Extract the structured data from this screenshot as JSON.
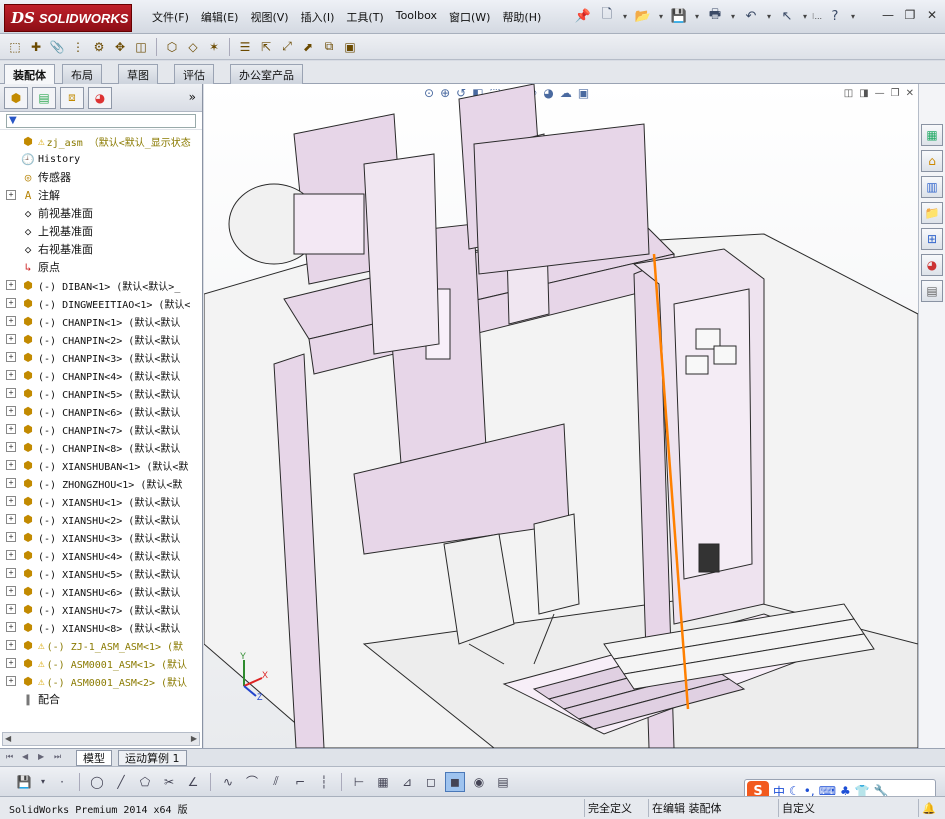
{
  "titlebar": {
    "brand_ds": "DS",
    "brand_name": "SOLIDWORKS",
    "menus": [
      "文件(F)",
      "编辑(E)",
      "视图(V)",
      "插入(I)",
      "工具(T)",
      "Toolbox",
      "窗口(W)",
      "帮助(H)"
    ],
    "overflow": "⁝...",
    "help": "?"
  },
  "command_tabs": [
    "装配体",
    "布局",
    "草图",
    "评估",
    "办公室产品"
  ],
  "feature_tree": {
    "root_label": "zj_asm （默认<默认_显示状态",
    "items": [
      {
        "label": "History",
        "type": "history"
      },
      {
        "label": "传感器",
        "type": "sensor"
      },
      {
        "label": "注解",
        "type": "annotation"
      },
      {
        "label": "前视基准面",
        "type": "plane"
      },
      {
        "label": "上视基准面",
        "type": "plane"
      },
      {
        "label": "右视基准面",
        "type": "plane"
      },
      {
        "label": "原点",
        "type": "origin"
      },
      {
        "label": "(-) DIBAN<1> (默认<默认>_",
        "type": "part"
      },
      {
        "label": "(-) DINGWEEITIAO<1> (默认<",
        "type": "part"
      },
      {
        "label": "(-) CHANPIN<1> (默认<默认",
        "type": "part"
      },
      {
        "label": "(-) CHANPIN<2> (默认<默认",
        "type": "part"
      },
      {
        "label": "(-) CHANPIN<3> (默认<默认",
        "type": "part"
      },
      {
        "label": "(-) CHANPIN<4> (默认<默认",
        "type": "part"
      },
      {
        "label": "(-) CHANPIN<5> (默认<默认",
        "type": "part"
      },
      {
        "label": "(-) CHANPIN<6> (默认<默认",
        "type": "part"
      },
      {
        "label": "(-) CHANPIN<7> (默认<默认",
        "type": "part"
      },
      {
        "label": "(-) CHANPIN<8> (默认<默认",
        "type": "part"
      },
      {
        "label": "(-) XIANSHUBAN<1> (默认<默",
        "type": "part"
      },
      {
        "label": "(-) ZHONGZHOU<1> (默认<默",
        "type": "part"
      },
      {
        "label": "(-) XIANSHU<1> (默认<默认",
        "type": "part"
      },
      {
        "label": "(-) XIANSHU<2> (默认<默认",
        "type": "part"
      },
      {
        "label": "(-) XIANSHU<3> (默认<默认",
        "type": "part"
      },
      {
        "label": "(-) XIANSHU<4> (默认<默认",
        "type": "part"
      },
      {
        "label": "(-) XIANSHU<5> (默认<默认",
        "type": "part"
      },
      {
        "label": "(-) XIANSHU<6> (默认<默认",
        "type": "part"
      },
      {
        "label": "(-) XIANSHU<7> (默认<默认",
        "type": "part"
      },
      {
        "label": "(-) XIANSHU<8> (默认<默认",
        "type": "part"
      },
      {
        "label": "(-) ZJ-1_ASM_ASM<1> (默",
        "type": "subasm"
      },
      {
        "label": "(-) ASM0001_ASM<1> (默认",
        "type": "subasm"
      },
      {
        "label": "(-) ASM0001_ASM<2> (默认",
        "type": "subasm"
      },
      {
        "label": "配合",
        "type": "mates"
      }
    ]
  },
  "bottom_tabs": [
    "模型",
    "运动算例 1"
  ],
  "ime": {
    "brand": "S",
    "mode": "中"
  },
  "status": {
    "product": "SolidWorks Premium 2014 x64 版",
    "definition": "完全定义",
    "editing": "在编辑 装配体",
    "custom": "自定义"
  },
  "colors": {
    "part_pink": "#e7d6e8",
    "edge": "#2a2a2a",
    "accent_orange": "#ff8000",
    "brand_red": "#b01520"
  }
}
